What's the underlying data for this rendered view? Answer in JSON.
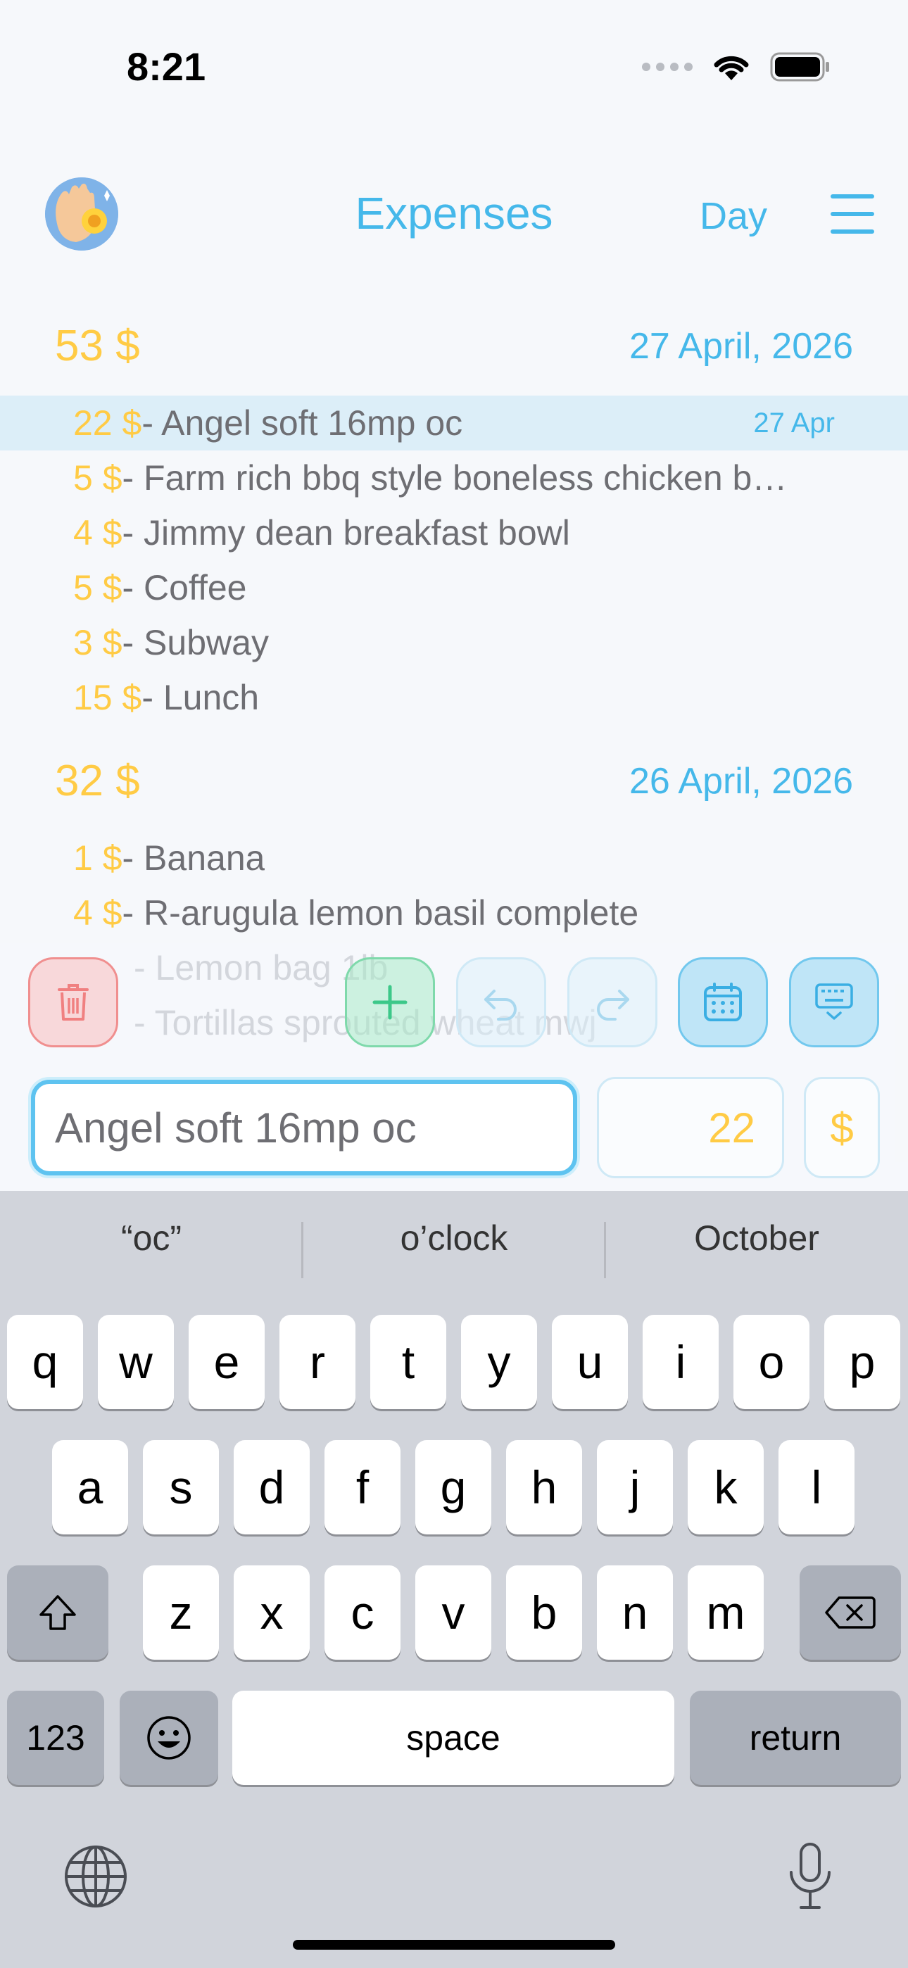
{
  "status_bar": {
    "time": "8:21"
  },
  "header": {
    "title": "Expenses",
    "period": "Day"
  },
  "groups": [
    {
      "total": "53 $",
      "date": "27 April, 2026",
      "items": [
        {
          "amount": "22 $",
          "name": "- Angel soft 16mp oc",
          "short_date": "27 Apr",
          "selected": true
        },
        {
          "amount": "5 $",
          "name": "- Farm rich bbq style boneless chicken b…"
        },
        {
          "amount": "4 $",
          "name": "- Jimmy dean breakfast bowl"
        },
        {
          "amount": "5 $",
          "name": "- Coffee"
        },
        {
          "amount": "3 $",
          "name": "- Subway"
        },
        {
          "amount": "15 $",
          "name": "- Lunch"
        }
      ]
    },
    {
      "total": "32 $",
      "date": "26 April, 2026",
      "items": [
        {
          "amount": "1 $",
          "name": "- Banana"
        },
        {
          "amount": "4 $",
          "name": "- R-arugula lemon basil complete"
        },
        {
          "amount": "",
          "name": "- Lemon bag 1lb"
        },
        {
          "amount": "",
          "name": "- Tortillas sprouted wheat mwj"
        }
      ]
    }
  ],
  "toolbar": {
    "icons": [
      "trash-icon",
      "plus-icon",
      "undo-icon",
      "redo-icon",
      "calendar-icon",
      "keyboard-dismiss-icon"
    ]
  },
  "entry": {
    "name_value": "Angel soft 16mp oc",
    "amount_value": "22",
    "currency": "$"
  },
  "keyboard": {
    "suggestions": [
      "“oc”",
      "o’clock",
      "October"
    ],
    "row1": [
      "q",
      "w",
      "e",
      "r",
      "t",
      "y",
      "u",
      "i",
      "o",
      "p"
    ],
    "row2": [
      "a",
      "s",
      "d",
      "f",
      "g",
      "h",
      "j",
      "k",
      "l"
    ],
    "row3": [
      "z",
      "x",
      "c",
      "v",
      "b",
      "n",
      "m"
    ],
    "numbers_label": "123",
    "space_label": "space",
    "return_label": "return"
  },
  "colors": {
    "accent": "#45b8ea",
    "amount": "#ffcb45",
    "text": "#6e6e73"
  }
}
